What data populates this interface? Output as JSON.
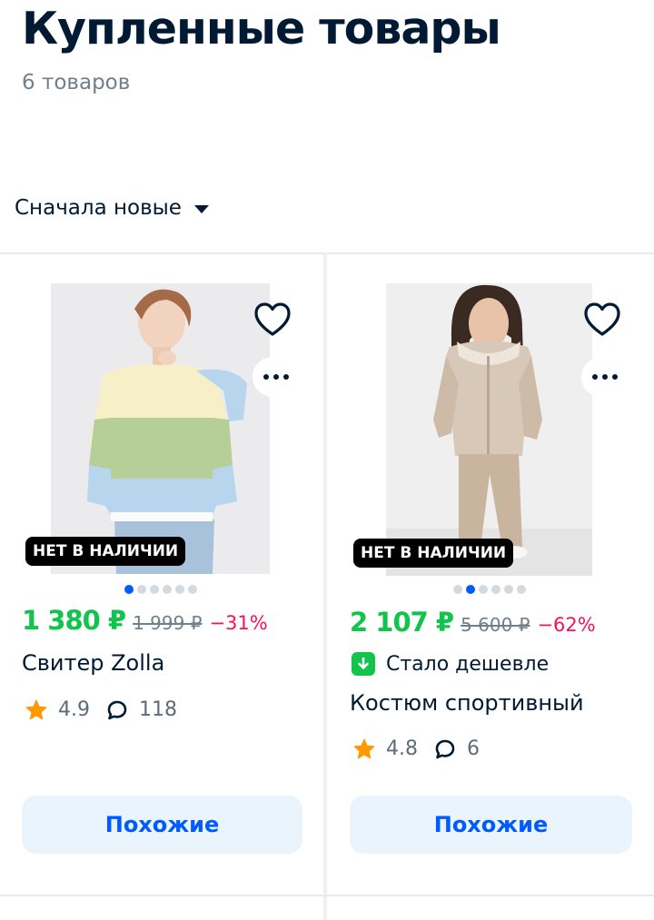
{
  "header": {
    "title": "Купленные товары",
    "count_label": "6 товаров"
  },
  "sort": {
    "label": "Сначала новые"
  },
  "products": [
    {
      "name": "Свитер Zolla",
      "price": "1 380 ₽",
      "old_price": "1 999 ₽",
      "discount": "−31%",
      "badge": "НЕТ В НАЛИЧИИ",
      "rating": "4.9",
      "reviews": "118",
      "similar_label": "Похожие",
      "image_dots": 6,
      "active_dot": 1
    },
    {
      "name": "Костюм спортивный",
      "price": "2 107 ₽",
      "old_price": "5 600 ₽",
      "discount": "−62%",
      "badge": "НЕТ В НАЛИЧИИ",
      "promo": "Стало дешевле",
      "rating": "4.8",
      "reviews": "6",
      "similar_label": "Похожие",
      "image_dots": 6,
      "active_dot": 2
    }
  ],
  "colors": {
    "price_green": "#10c44c",
    "discount_pink": "#f91155",
    "accent_blue": "#005bff",
    "button_bg": "#e9f4fd",
    "star": "#ff9900"
  }
}
